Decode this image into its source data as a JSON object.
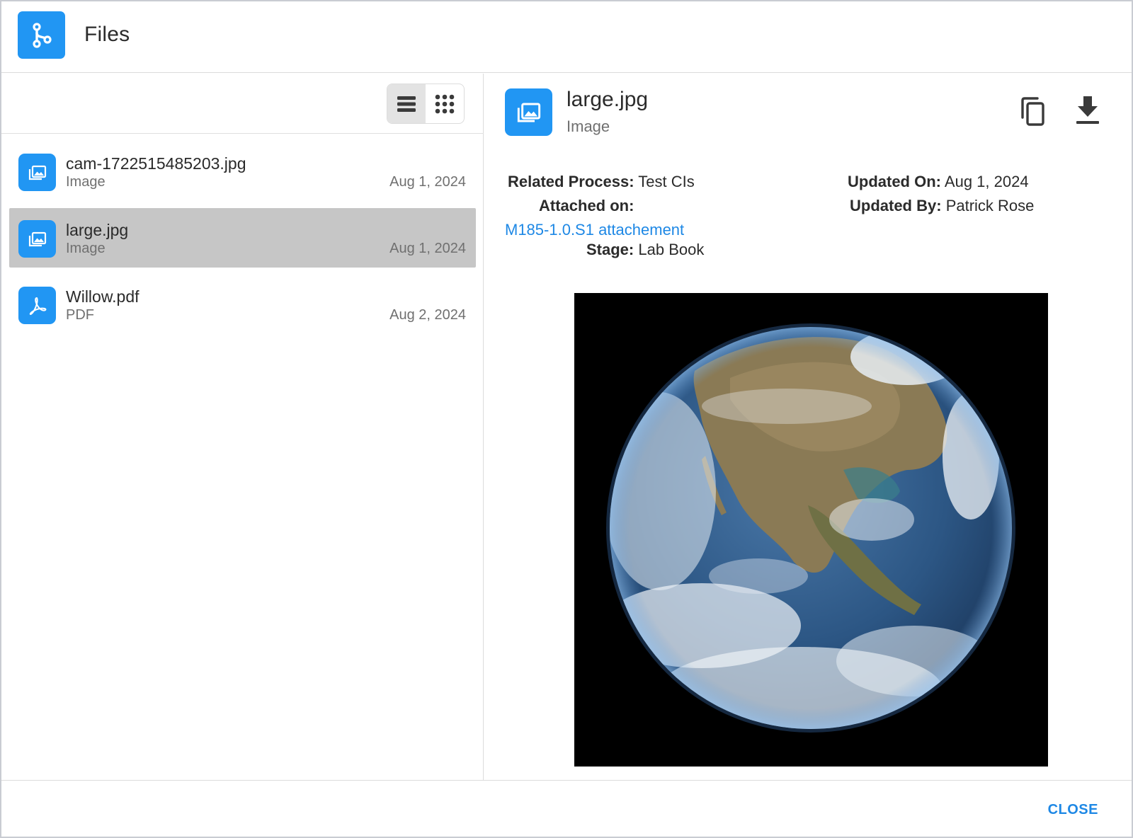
{
  "header": {
    "title": "Files",
    "icon": "branch-icon"
  },
  "toolbar": {
    "views": [
      "list-view-icon",
      "grid-view-icon"
    ],
    "active_view": "list"
  },
  "files": [
    {
      "name": "cam-1722515485203.jpg",
      "type": "Image",
      "date": "Aug 1, 2024",
      "icon": "image-file-icon"
    },
    {
      "name": "large.jpg",
      "type": "Image",
      "date": "Aug 1, 2024",
      "icon": "image-file-icon",
      "selected": true
    },
    {
      "name": "Willow.pdf",
      "type": "PDF",
      "date": "Aug 2, 2024",
      "icon": "pdf-file-icon"
    }
  ],
  "detail": {
    "name": "large.jpg",
    "type": "Image",
    "related_process_label": "Related Process:",
    "related_process_value": "Test CIs",
    "attached_on_label": "Attached on:",
    "attached_on_link": "M185-1.0.S1 attachement",
    "stage_label": "Stage:",
    "stage_value": "Lab Book",
    "updated_on_label": "Updated On:",
    "updated_on_value": "Aug 1, 2024",
    "updated_by_label": "Updated By:",
    "updated_by_value": "Patrick Rose"
  },
  "footer": {
    "close_label": "CLOSE"
  },
  "colors": {
    "accent": "#2196f3",
    "link": "#1e88e5",
    "selected_row": "#c6c6c6"
  }
}
